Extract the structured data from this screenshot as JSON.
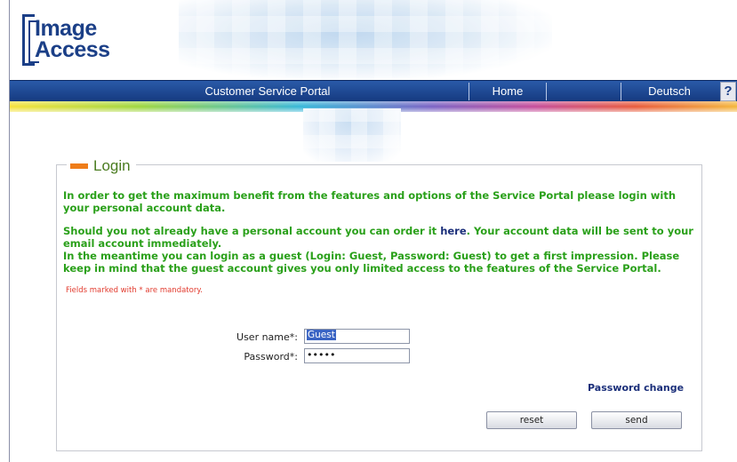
{
  "logo": {
    "line1": "Image",
    "line2": "Access"
  },
  "nav": {
    "title": "Customer Service Portal",
    "home": "Home",
    "language": "Deutsch",
    "help": "?"
  },
  "login": {
    "title": "Login",
    "intro": "In order to get the maximum benefit from the features and options of the Service Portal please login with your personal account data.",
    "order_pre": "Should you not already have a personal account you can order it ",
    "order_link": "here",
    "order_post": ". Your account data will be sent to your email account immediately.",
    "guest_info": "In the meantime you can login as a guest (Login: Guest, Password: Guest)  to get a first impression. Please keep in mind that the guest account gives you only limited access to the features of the Service Portal.",
    "mandatory_note": "Fields marked with * are mandatory.",
    "username_label": "User name*:",
    "username_value": "Guest",
    "password_label": "Password*:",
    "password_value": "•••••",
    "password_change": "Password change",
    "reset_label": "reset",
    "send_label": "send"
  },
  "colors": {
    "nav_blue": "#1b3f87",
    "message_green": "#2aa01a",
    "legend_orange": "#ef7d1a",
    "mandatory_red": "#e23b2e"
  }
}
